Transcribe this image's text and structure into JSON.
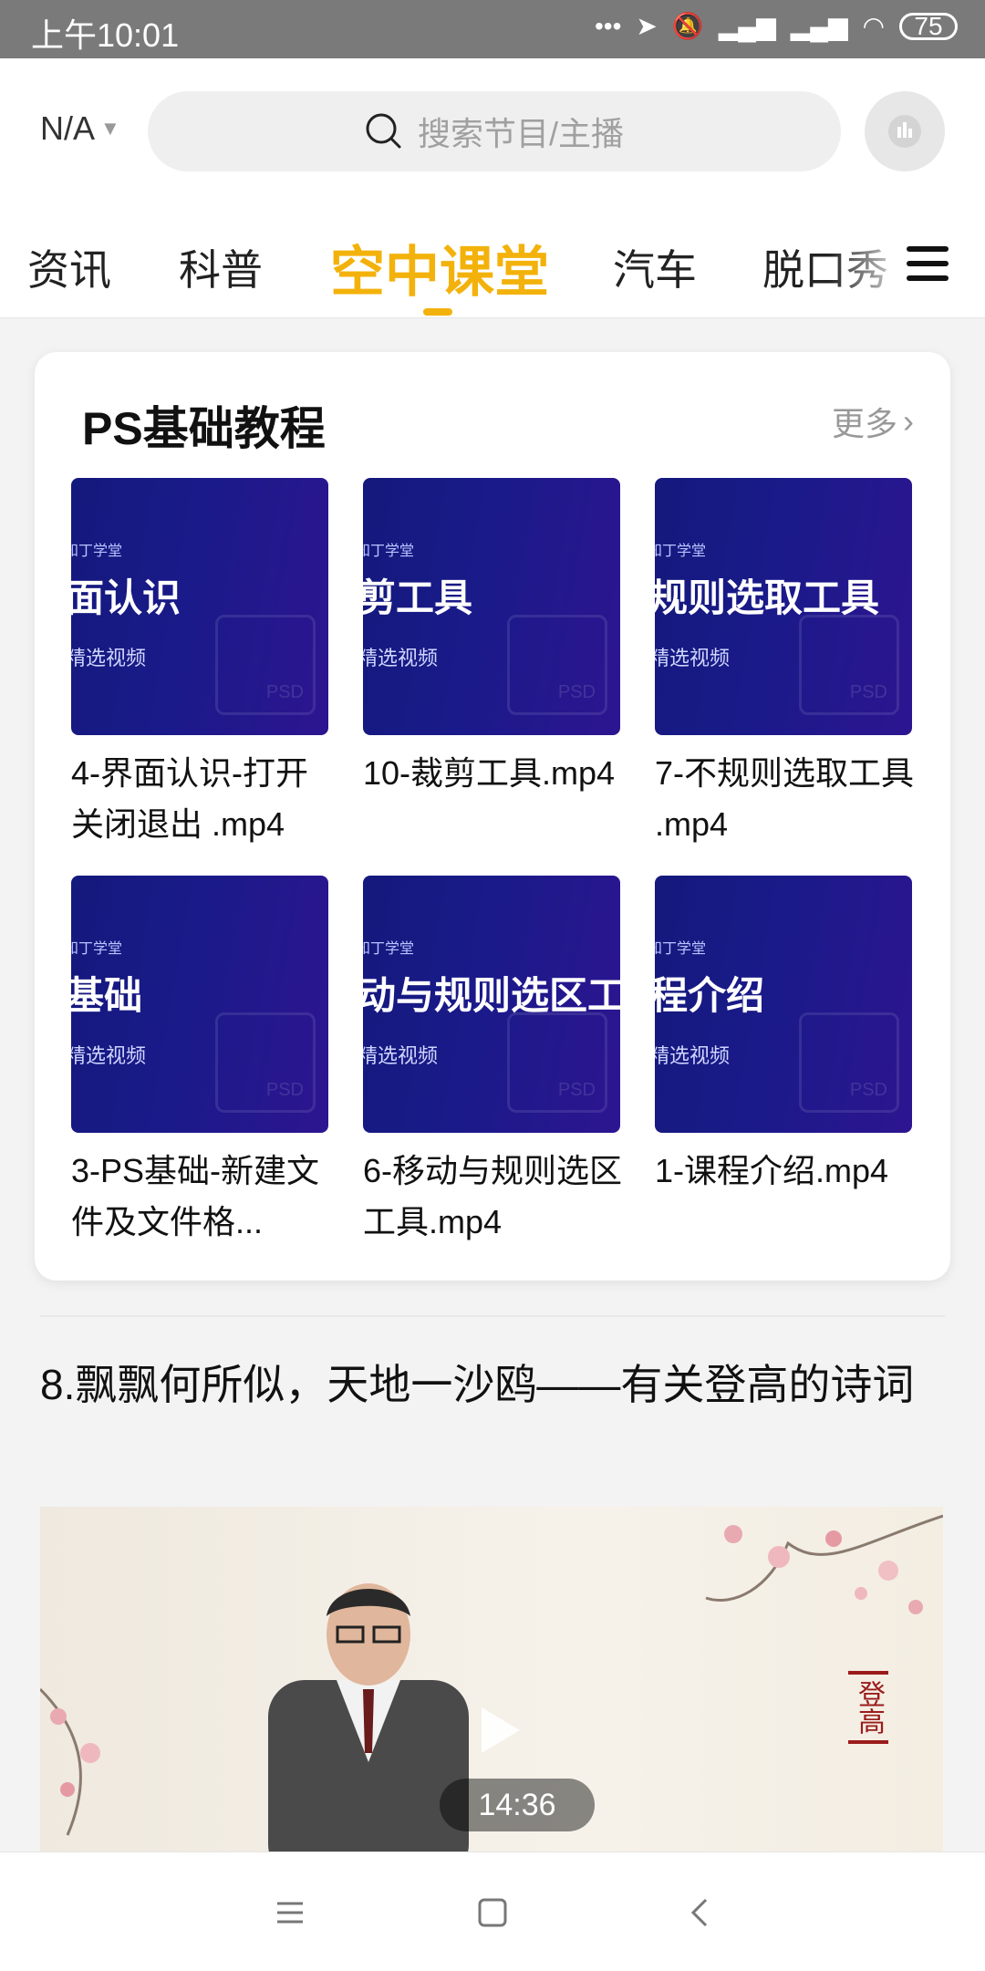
{
  "status_bar": {
    "time": "上午10:01",
    "battery": "75",
    "icons": [
      "more-dots-icon",
      "location-icon",
      "mute-icon",
      "hd-signal-icon",
      "signal-icon",
      "wifi-icon"
    ]
  },
  "header": {
    "location": "N/A",
    "search_placeholder": "搜索节目/主播"
  },
  "tabs": [
    "资讯",
    "科普",
    "空中课堂",
    "汽车",
    "脱口秀"
  ],
  "active_tab": "空中课堂",
  "accent_color": "#f3b20b",
  "section": {
    "title": "PS基础教程",
    "more": "更多",
    "items": [
      {
        "thumb_text": "面认识",
        "caption": "4-界面认识-打开关闭退出 .mp4"
      },
      {
        "thumb_text": "剪工具",
        "caption": "10-裁剪工具.mp4"
      },
      {
        "thumb_text": "规则选取工具",
        "caption": "7-不规则选取工具 .mp4"
      },
      {
        "thumb_text": "基础",
        "caption": "3-PS基础-新建文件及文件格..."
      },
      {
        "thumb_text": "动与规则选区工具",
        "caption": "6-移动与规则选区工具.mp4"
      },
      {
        "thumb_text": "程介绍",
        "caption": "1-课程介绍.mp4"
      }
    ],
    "thumb_subtext": "精选视频",
    "thumb_brand": "知丁学堂"
  },
  "article": {
    "title": "8.飘飘何所似，天地一沙鸥——有关登高的诗词",
    "duration": "14:36",
    "seal_text": "登高"
  },
  "navbar": [
    "menu-icon",
    "home-icon",
    "back-icon"
  ]
}
